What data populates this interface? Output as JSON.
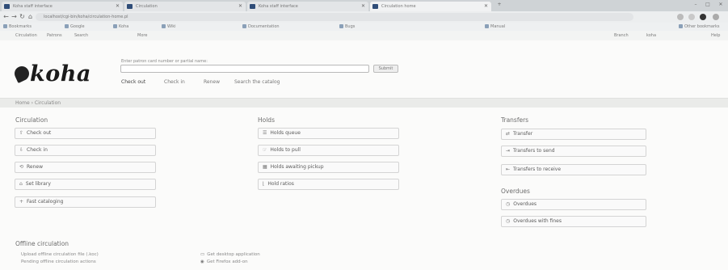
{
  "browser": {
    "tabs": [
      {
        "label": "Koha staff interface",
        "active": false
      },
      {
        "label": "Circulation",
        "active": false
      },
      {
        "label": "Koha staff interface",
        "active": false
      },
      {
        "label": "Circulation home",
        "active": true
      }
    ],
    "url": "localhost/cgi-bin/koha/circulation-home.pl",
    "bookmarks": [
      "Bookmarks",
      "Google",
      "Koha",
      "Wiki",
      "Documentation",
      "Bugs",
      "Manual",
      "Other bookmarks"
    ]
  },
  "koha_nav": {
    "left": [
      "Circulation",
      "Patrons",
      "Search",
      "More"
    ],
    "right": [
      "Branch",
      "koha",
      "Help"
    ]
  },
  "header": {
    "logo_text": "koha",
    "search_hint": "Enter patron card number or partial name:",
    "submit_label": "Submit",
    "subtabs": [
      "Check out",
      "Check in",
      "Renew",
      "Search the catalog"
    ]
  },
  "breadcrumb": "Home › Circulation",
  "circulation": {
    "title": "Circulation",
    "items": [
      {
        "label": "Check out",
        "icon": "upload-icon"
      },
      {
        "label": "Check in",
        "icon": "download-icon"
      },
      {
        "label": "Renew",
        "icon": "retweet-icon"
      },
      {
        "label": "Set library",
        "icon": "home-icon"
      },
      {
        "label": "Fast cataloging",
        "icon": "plus-icon"
      }
    ]
  },
  "holds": {
    "title": "Holds",
    "items": [
      {
        "label": "Holds queue",
        "icon": "list-icon"
      },
      {
        "label": "Holds to pull",
        "icon": "hand-icon"
      },
      {
        "label": "Holds awaiting pickup",
        "icon": "calendar-icon"
      },
      {
        "label": "Hold ratios",
        "icon": "chart-icon"
      }
    ]
  },
  "transfers": {
    "title": "Transfers",
    "items": [
      {
        "label": "Transfer",
        "icon": "exchange-icon"
      },
      {
        "label": "Transfers to send",
        "icon": "send-icon"
      },
      {
        "label": "Transfers to receive",
        "icon": "receive-icon"
      }
    ]
  },
  "overdues": {
    "title": "Overdues",
    "items": [
      {
        "label": "Overdues",
        "icon": "clock-icon"
      },
      {
        "label": "Overdues with fines",
        "icon": "clock-icon"
      }
    ]
  },
  "offline": {
    "title": "Offline circulation",
    "col1": [
      "Upload offline circulation file (.koc)",
      "Pending offline circulation actions"
    ],
    "col2": [
      "Get desktop application",
      "Get Firefox add-on"
    ]
  }
}
